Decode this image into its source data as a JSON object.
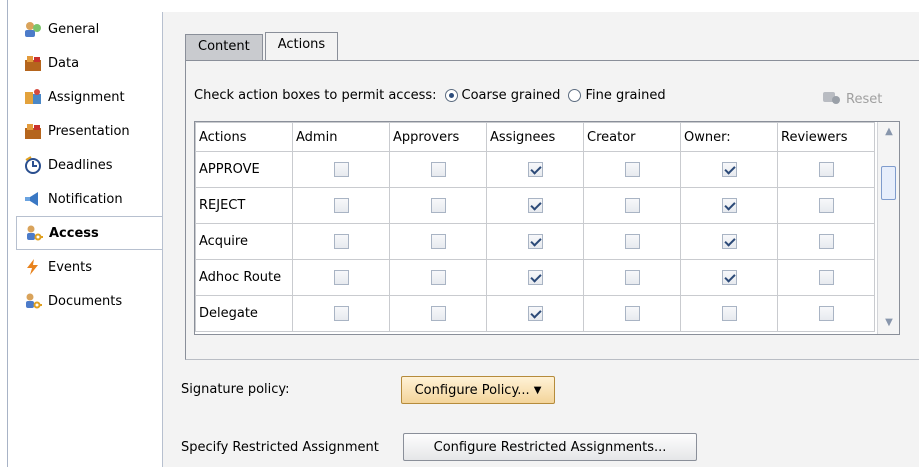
{
  "sidebar": {
    "items": [
      {
        "label": "General",
        "icon": "general-icon"
      },
      {
        "label": "Data",
        "icon": "data-icon"
      },
      {
        "label": "Assignment",
        "icon": "assignment-icon"
      },
      {
        "label": "Presentation",
        "icon": "presentation-icon"
      },
      {
        "label": "Deadlines",
        "icon": "deadlines-icon"
      },
      {
        "label": "Notification",
        "icon": "notification-icon"
      },
      {
        "label": "Access",
        "icon": "access-icon",
        "active": true
      },
      {
        "label": "Events",
        "icon": "events-icon"
      },
      {
        "label": "Documents",
        "icon": "documents-icon"
      }
    ]
  },
  "tabs": [
    {
      "label": "Content",
      "selected": false
    },
    {
      "label": "Actions",
      "selected": true
    }
  ],
  "access": {
    "instruction": "Check action boxes to permit access:",
    "granularity": {
      "options": [
        "Coarse grained",
        "Fine grained"
      ],
      "selected": "Coarse grained"
    },
    "reset_label": "Reset"
  },
  "table": {
    "columns": [
      "Actions",
      "Admin",
      "Approvers",
      "Assignees",
      "Creator",
      "Owner:",
      "Reviewers"
    ],
    "rows": [
      {
        "action": "APPROVE",
        "checks": [
          false,
          false,
          true,
          false,
          true,
          false
        ]
      },
      {
        "action": "REJECT",
        "checks": [
          false,
          false,
          true,
          false,
          true,
          false
        ]
      },
      {
        "action": "Acquire",
        "checks": [
          false,
          false,
          true,
          false,
          true,
          false
        ]
      },
      {
        "action": "Adhoc Route",
        "checks": [
          false,
          false,
          true,
          false,
          true,
          false
        ]
      },
      {
        "action": "Delegate",
        "checks": [
          false,
          false,
          true,
          false,
          false,
          false
        ]
      }
    ]
  },
  "signature": {
    "label": "Signature policy:",
    "button": "Configure Policy..."
  },
  "restricted": {
    "label": "Specify Restricted Assignment",
    "button": "Configure Restricted Assignments..."
  },
  "colors": {
    "check": "#2c4a78",
    "primary_button": "#f3d49a"
  }
}
